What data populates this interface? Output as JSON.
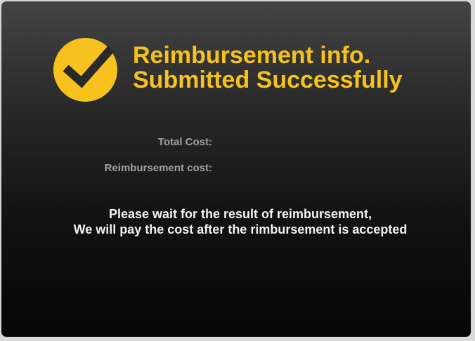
{
  "dialog": {
    "icon": "check-circle-icon",
    "accent_color": "#f7c21e",
    "title_line1": "Reimbursement info.",
    "title_line2": "Submitted Successfully",
    "fields": [
      {
        "label": "Total Cost:",
        "value": ""
      },
      {
        "label": "Reimbursement cost:",
        "value": ""
      }
    ],
    "message_line1": "Please wait for the result of reimbursement,",
    "message_line2": "We will pay the cost after the rimbursement is accepted"
  }
}
